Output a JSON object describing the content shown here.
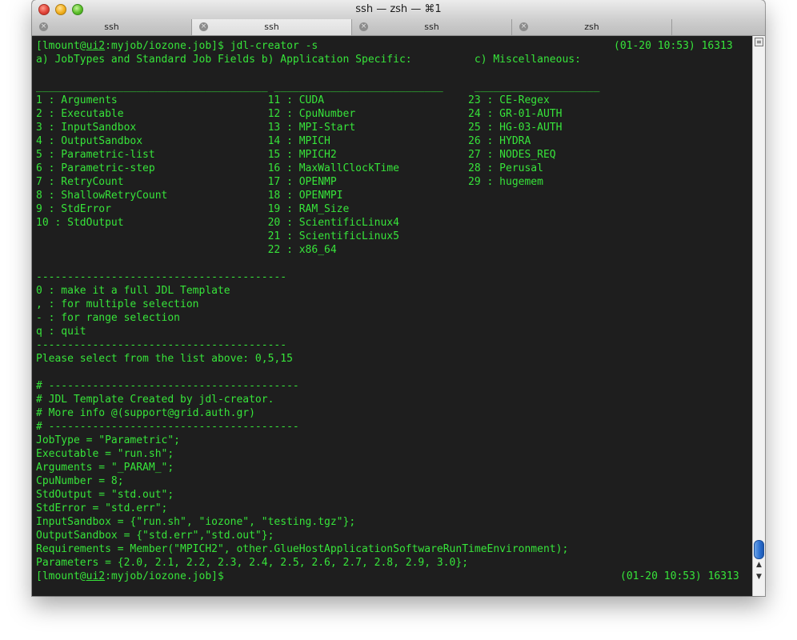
{
  "window": {
    "title": "ssh — zsh — ⌘1"
  },
  "tabs": [
    {
      "label": "ssh",
      "active": true
    },
    {
      "label": "ssh",
      "active": true
    },
    {
      "label": "ssh",
      "active": false
    },
    {
      "label": "zsh",
      "active": false
    }
  ],
  "terminal": {
    "color": "#37e43a",
    "prompt_user": "lmount",
    "prompt_host": "ui2",
    "prompt_path": "myjob/iozone.job",
    "status_time": "(01-20 10:53)",
    "status_pid": "16313",
    "command": "jdl-creator -s",
    "lines": [
      "a) JobTypes and Standard Job Fields b) Application Specific:          c) Miscellaneous:",
      "",
      "_____________________________________ ___________________________     ____________________",
      "1 : Arguments                        11 : CUDA                       23 : CE-Regex",
      "2 : Executable                       12 : CpuNumber                  24 : GR-01-AUTH",
      "3 : InputSandbox                     13 : MPI-Start                  25 : HG-03-AUTH",
      "4 : OutputSandbox                    14 : MPICH                      26 : HYDRA",
      "5 : Parametric-list                  15 : MPICH2                     27 : NODES_REQ",
      "6 : Parametric-step                  16 : MaxWallClockTime           28 : Perusal",
      "7 : RetryCount                       17 : OPENMP                     29 : hugemem",
      "8 : ShallowRetryCount                18 : OPENMPI",
      "9 : StdError                         19 : RAM_Size",
      "10 : StdOutput                       20 : ScientificLinux4",
      "                                     21 : ScientificLinux5",
      "                                     22 : x86_64",
      "",
      "----------------------------------------",
      "0 : make it a full JDL Template",
      ", : for multiple selection",
      "- : for range selection",
      "q : quit",
      "----------------------------------------",
      "Please select from the list above: 0,5,15",
      "",
      "# ----------------------------------------",
      "# JDL Template Created by jdl-creator.",
      "# More info @(support@grid.auth.gr)",
      "# ----------------------------------------",
      "JobType = \"Parametric\";",
      "Executable = \"run.sh\";",
      "Arguments = \"_PARAM_\";",
      "CpuNumber = 8;",
      "StdOutput = \"std.out\";",
      "StdError = \"std.err\";",
      "InputSandbox = {\"run.sh\", \"iozone\", \"testing.tgz\"};",
      "OutputSandbox = {\"std.err\",\"std.out\"};",
      "Requirements = Member(\"MPICH2\", other.GlueHostApplicationSoftwareRunTimeEnvironment);",
      "Parameters = {2.0, 2.1, 2.2, 2.3, 2.4, 2.5, 2.6, 2.7, 2.8, 2.9, 3.0};",
      ""
    ]
  }
}
